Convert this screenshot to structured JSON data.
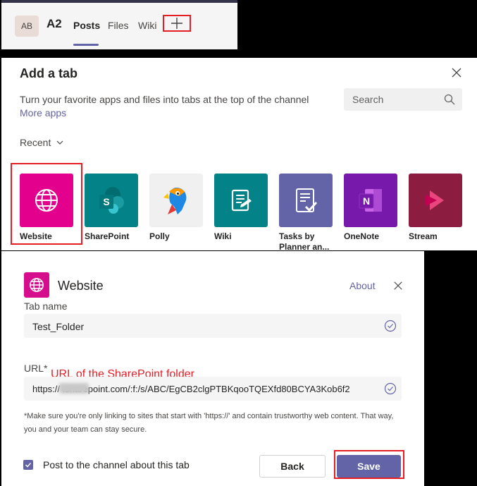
{
  "header": {
    "avatar_initials": "AB",
    "team_name": "A2",
    "tabs": [
      {
        "label": "Posts",
        "active": true
      },
      {
        "label": "Files",
        "active": false
      },
      {
        "label": "Wiki",
        "active": false
      }
    ],
    "add_tab_icon": "plus-icon"
  },
  "add_tab_dialog": {
    "title": "Add a tab",
    "description": "Turn your favorite apps and files into tabs at the top of the channel",
    "more_apps": "More apps",
    "search_placeholder": "Search",
    "recent_label": "Recent",
    "apps": [
      {
        "label": "Website",
        "color": "#e3008c",
        "icon": "globe-icon"
      },
      {
        "label": "SharePoint",
        "color": "#038387",
        "icon": "sharepoint-icon"
      },
      {
        "label": "Polly",
        "color": "#f0f0f0",
        "icon": "parrot-icon"
      },
      {
        "label": "Wiki",
        "color": "#038387",
        "icon": "wiki-icon"
      },
      {
        "label": "Tasks by\nPlanner an...",
        "color": "#6264a7",
        "icon": "tasks-icon"
      },
      {
        "label": "OneNote",
        "color": "#7719aa",
        "icon": "onenote-icon"
      },
      {
        "label": "Stream",
        "color": "#8c1d40",
        "icon": "stream-icon"
      }
    ]
  },
  "website_dialog": {
    "title": "Website",
    "about": "About",
    "tab_name_label": "Tab name",
    "tab_name_value": "Test_Folder",
    "url_label": "URL*",
    "url_annotation": "URL of the SharePoint folder",
    "url_value": "https://           .sharepoint.com/:f:/s/ABC/EgCB2clgPTBKqooTQEXfd80BCYA3Kob6f2",
    "note": "*Make sure you're only linking to sites that start with 'https://' and contain trustworthy web content. That way, you and your team can stay secure.",
    "post_checkbox_label": "Post to the channel about this tab",
    "post_checkbox_checked": true,
    "back_label": "Back",
    "save_label": "Save"
  },
  "colors": {
    "accent": "#6264a7",
    "highlight": "#e51d24"
  }
}
